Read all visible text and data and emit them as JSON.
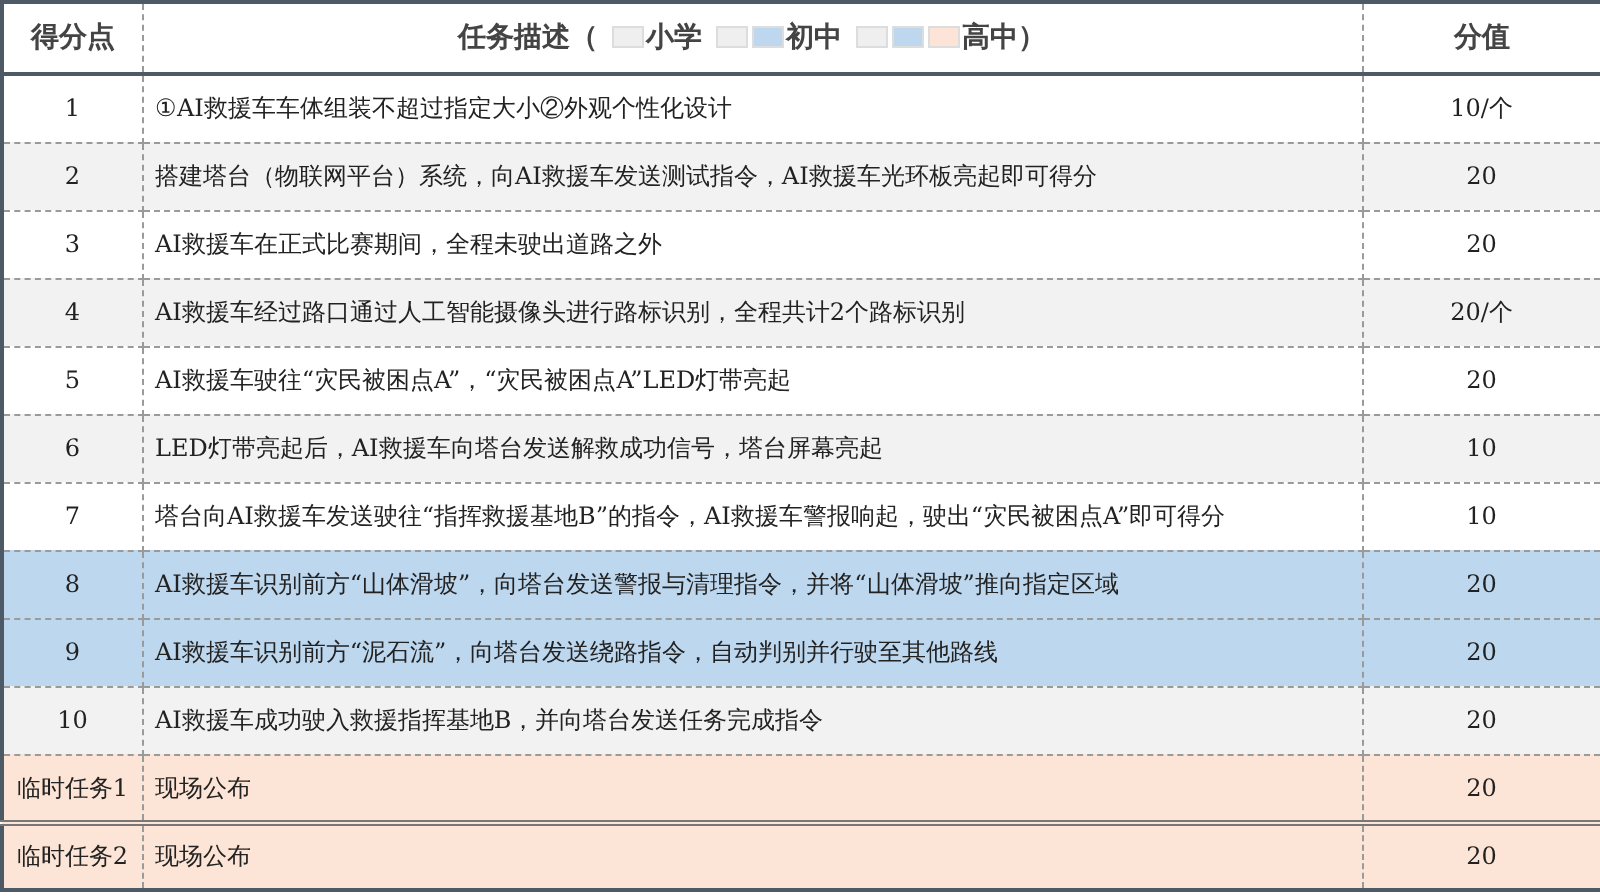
{
  "table": {
    "columns": [
      {
        "label": "得分点"
      },
      {
        "label": "任务描述（",
        "legend": [
          {
            "swatches": [
              {
                "color": "#efefef"
              }
            ],
            "label": "小学"
          },
          {
            "swatches": [
              {
                "color": "#efefef"
              },
              {
                "color": "#bdd7ee"
              }
            ],
            "label": "初中"
          },
          {
            "swatches": [
              {
                "color": "#efefef"
              },
              {
                "color": "#bdd7ee"
              },
              {
                "color": "#fce4d6"
              }
            ],
            "label": "高中）"
          }
        ]
      },
      {
        "label": "分值"
      }
    ],
    "rows": [
      {
        "point": "1",
        "task": "①AI救援车车体组装不超过指定大小②外观个性化设计",
        "score": "10/个",
        "color": "#ffffff"
      },
      {
        "point": "2",
        "task": "搭建塔台（物联网平台）系统，向AI救援车发送测试指令，AI救援车光环板亮起即可得分",
        "score": "20",
        "color": "#f2f2f2"
      },
      {
        "point": "3",
        "task": "AI救援车在正式比赛期间，全程未驶出道路之外",
        "score": "20",
        "color": "#ffffff"
      },
      {
        "point": "4",
        "task": "AI救援车经过路口通过人工智能摄像头进行路标识别，全程共计2个路标识别",
        "score": "20/个",
        "color": "#f2f2f2"
      },
      {
        "point": "5",
        "task": "AI救援车驶往“灾民被困点A”，“灾民被困点A”LED灯带亮起",
        "score": "20",
        "color": "#ffffff"
      },
      {
        "point": "6",
        "task": "LED灯带亮起后，AI救援车向塔台发送解救成功信号，塔台屏幕亮起",
        "score": "10",
        "color": "#f2f2f2"
      },
      {
        "point": "7",
        "task": "塔台向AI救援车发送驶往“指挥救援基地B”的指令，AI救援车警报响起，驶出“灾民被困点A”即可得分",
        "score": "10",
        "color": "#ffffff"
      },
      {
        "point": "8",
        "task": "AI救援车识别前方“山体滑坡”，向塔台发送警报与清理指令，并将“山体滑坡”推向指定区域",
        "score": "20",
        "color": "#bdd7ee"
      },
      {
        "point": "9",
        "task": "AI救援车识别前方“泥石流”，向塔台发送绕路指令，自动判别并行驶至其他路线",
        "score": "20",
        "color": "#bdd7ee"
      },
      {
        "point": "10",
        "task": "AI救援车成功驶入救援指挥基地B，并向塔台发送任务完成指令",
        "score": "20",
        "color": "#f2f2f2"
      },
      {
        "point": "临时任务1",
        "task": "现场公布",
        "score": "20",
        "color": "#fce4d6"
      },
      {
        "point": "临时任务2",
        "task": "现场公布",
        "score": "20",
        "color": "#fce4d6"
      }
    ]
  }
}
